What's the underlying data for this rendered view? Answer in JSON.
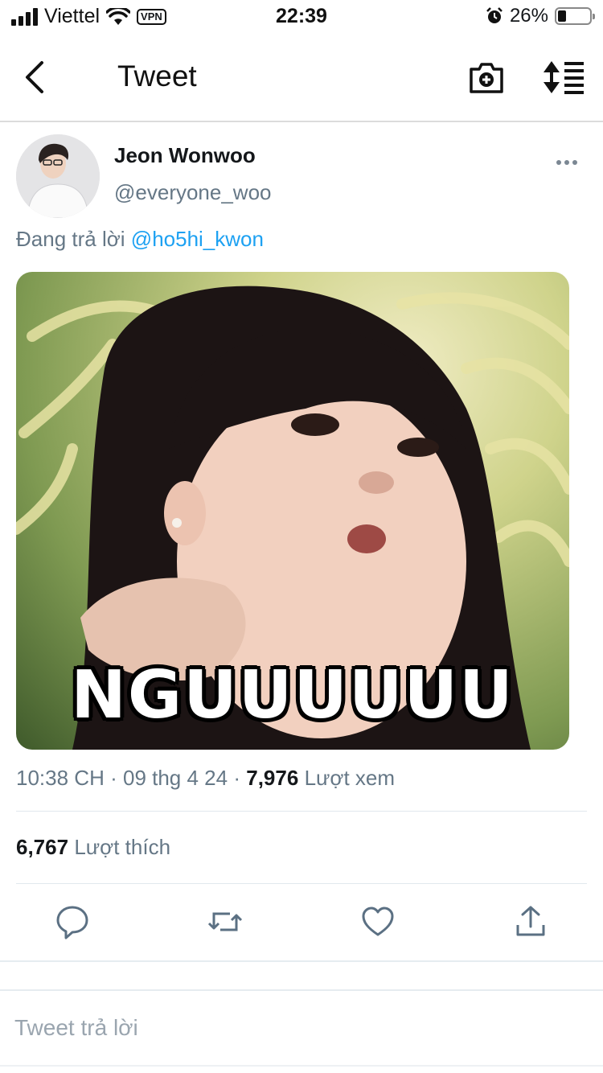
{
  "status_bar": {
    "carrier": "Viettel",
    "vpn_label": "VPN",
    "time": "22:39",
    "battery_percent_text": "26%",
    "battery_level": 0.26,
    "icons": [
      "signal-icon",
      "wifi-icon",
      "alarm-icon",
      "battery-icon"
    ]
  },
  "nav": {
    "title": "Tweet",
    "icons": [
      "back-chevron-icon",
      "camera-icon",
      "sort-icon"
    ]
  },
  "tweet": {
    "display_name": "Jeon Wonwoo",
    "handle": "@everyone_woo",
    "replying_prefix": "Đang trả lời",
    "replying_to": "@ho5hi_kwon",
    "media_caption": "NGUUUUUU",
    "time": "10:38 CH",
    "date": "09 thg 4 24",
    "views_count": "7,976",
    "views_label": "Lượt xem",
    "likes_count": "6,767",
    "likes_label": "Lượt thích",
    "actions": [
      "reply-icon",
      "retweet-icon",
      "like-icon",
      "share-icon"
    ]
  },
  "composer": {
    "placeholder": "Tweet trả lời"
  },
  "colors": {
    "link_blue": "#1da1f2",
    "secondary_text": "#657786",
    "action_icon": "#5b7083"
  }
}
